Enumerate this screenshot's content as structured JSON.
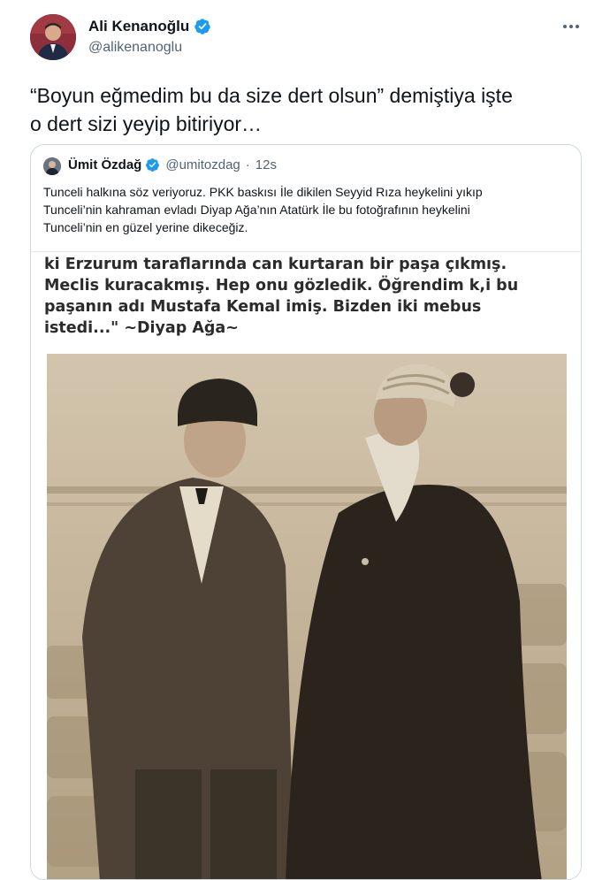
{
  "tweet": {
    "author": {
      "name": "Ali Kenanoğlu",
      "handle": "@alikenanoglu",
      "verified": true,
      "avatar_icon": "profile-photo"
    },
    "text_lines": [
      "“Boyun eğmedim bu da size dert olsun” demiştiya işte",
      "o dert sizi yeyip bitiriyor…"
    ],
    "more_icon": "more-horizontal-icon",
    "verified_color": "#1d9bf0"
  },
  "quoted_tweet": {
    "author": {
      "name": "Ümit Özdağ",
      "handle": "@umitozdag",
      "verified": true,
      "avatar_icon": "profile-photo"
    },
    "time_separator": "·",
    "timestamp": "12s",
    "text_lines": [
      "Tunceli halkına söz veriyoruz. PKK baskısı İle dikilen Seyyid Rıza heykelini yıkıp",
      "Tunceli’nin kahraman evladı Diyap Ağa’nın Atatürk İle bu fotoğrafının heykelini",
      "Tunceli’nin en güzel yerine dikeceğiz."
    ],
    "media": {
      "caption_lines": [
        "ki Erzurum taraflarında can kurtaran bir paşa çıkmış.",
        "Meclis kuracakmış. Hep onu gözledik. Öğrendim k,i bu",
        "paşanın adı Mustafa Kemal imiş. Bizden iki mebus",
        "istedi...\" ~Diyap Ağa~"
      ],
      "photo_description_icon": "sepia-photo"
    }
  }
}
